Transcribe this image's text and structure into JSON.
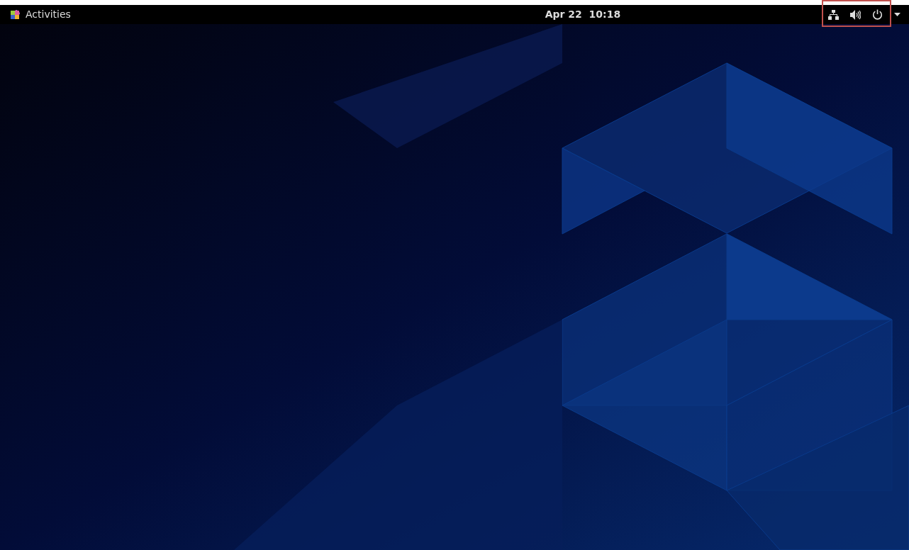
{
  "top_bar": {
    "activities": "Activities",
    "clock": "Apr 22  10:18"
  }
}
